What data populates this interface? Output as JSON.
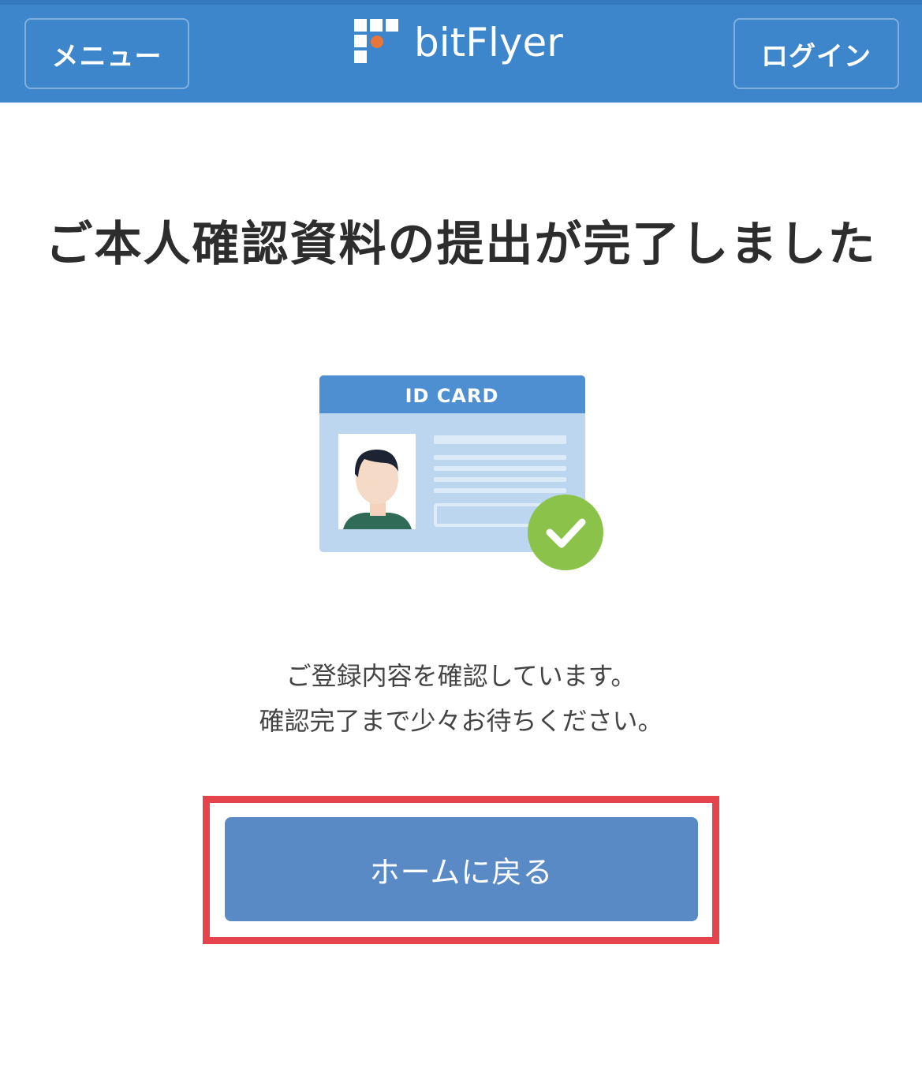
{
  "header": {
    "menu_label": "メニュー",
    "logo_text": "bitFlyer",
    "login_label": "ログイン",
    "background_color": "#3d86cc"
  },
  "main": {
    "title": "ご本人確認資料の提出が完了しました",
    "illustration": {
      "card_label": "ID CARD",
      "check_icon": "check-circle-icon",
      "check_color": "#8bc34a"
    },
    "message_line1": "ご登録内容を確認しています。",
    "message_line2": "確認完了まで少々お待ちください。",
    "home_button_label": "ホームに戻る",
    "highlight_color": "#e5444d"
  }
}
